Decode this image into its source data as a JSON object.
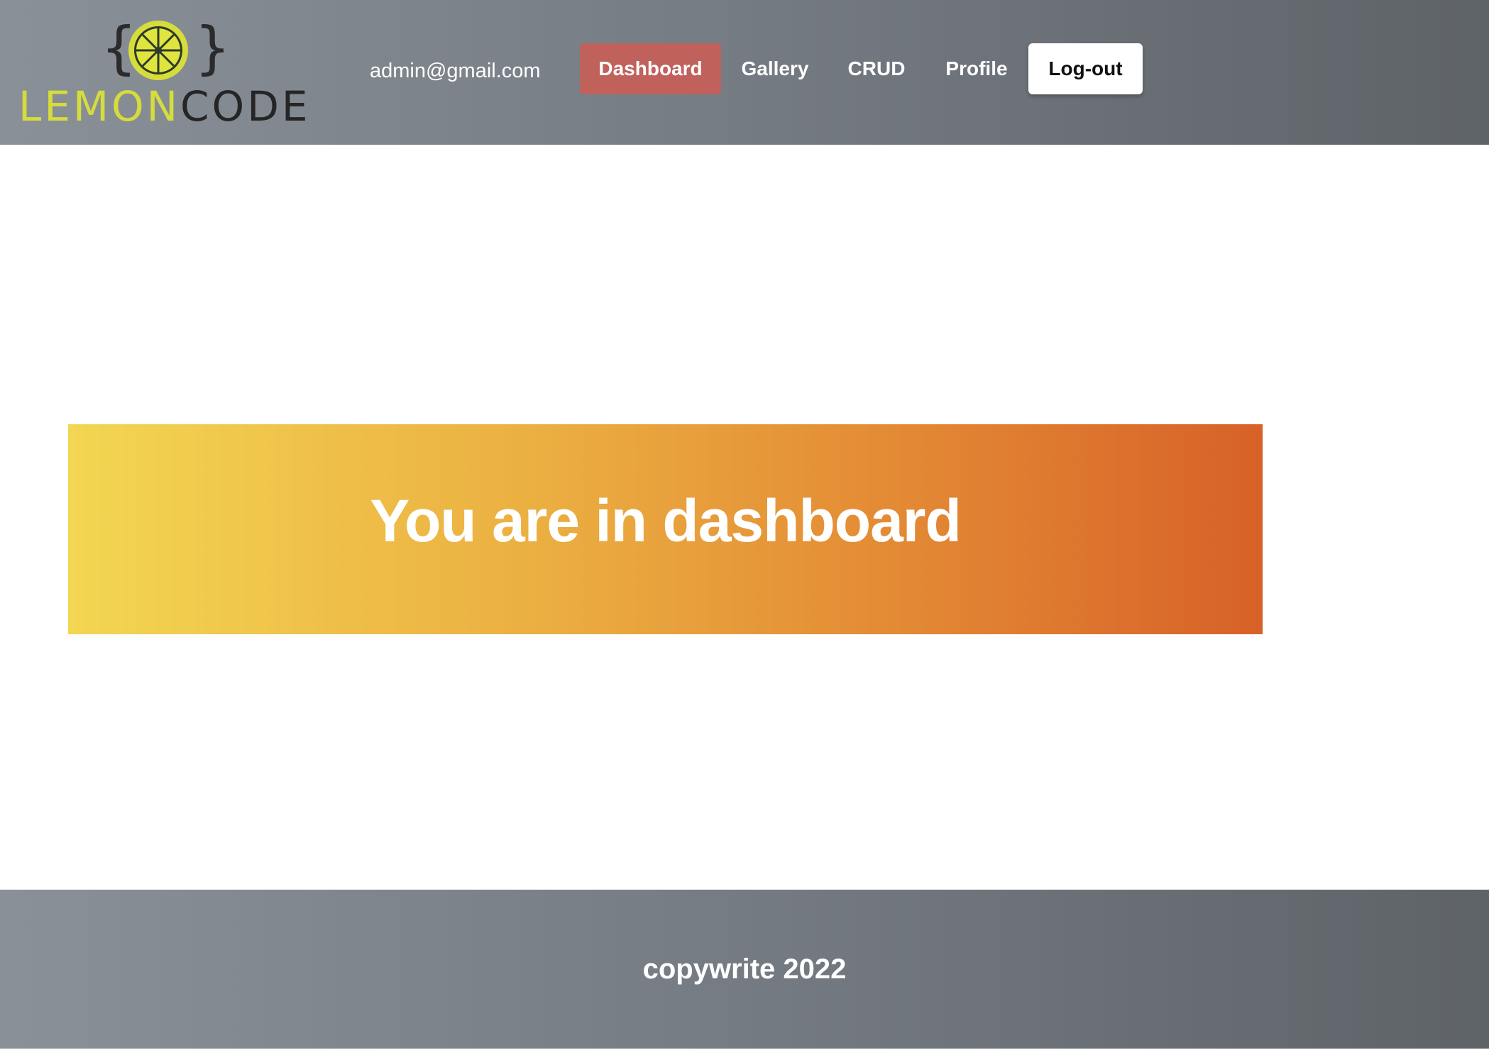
{
  "header": {
    "logo": {
      "word_part1": "LEMON",
      "word_part2": "CODE",
      "icon": "lemon-slice-icon",
      "brace_left": "{",
      "brace_right": "}"
    },
    "user_email": "admin@gmail.com",
    "nav": {
      "dashboard": "Dashboard",
      "gallery": "Gallery",
      "crud": "CRUD",
      "profile": "Profile",
      "logout": "Log-out"
    },
    "active_item": "dashboard"
  },
  "main": {
    "banner_title": "You are in dashboard"
  },
  "footer": {
    "text": "copywrite 2022"
  },
  "colors": {
    "header_gradient_start": "#8a9098",
    "header_gradient_end": "#5e6368",
    "active_nav_bg": "#c0615c",
    "banner_gradient_start": "#f3d652",
    "banner_gradient_end": "#d76128",
    "logo_lemon": "#d5dc3c",
    "logo_dark": "#252525"
  }
}
